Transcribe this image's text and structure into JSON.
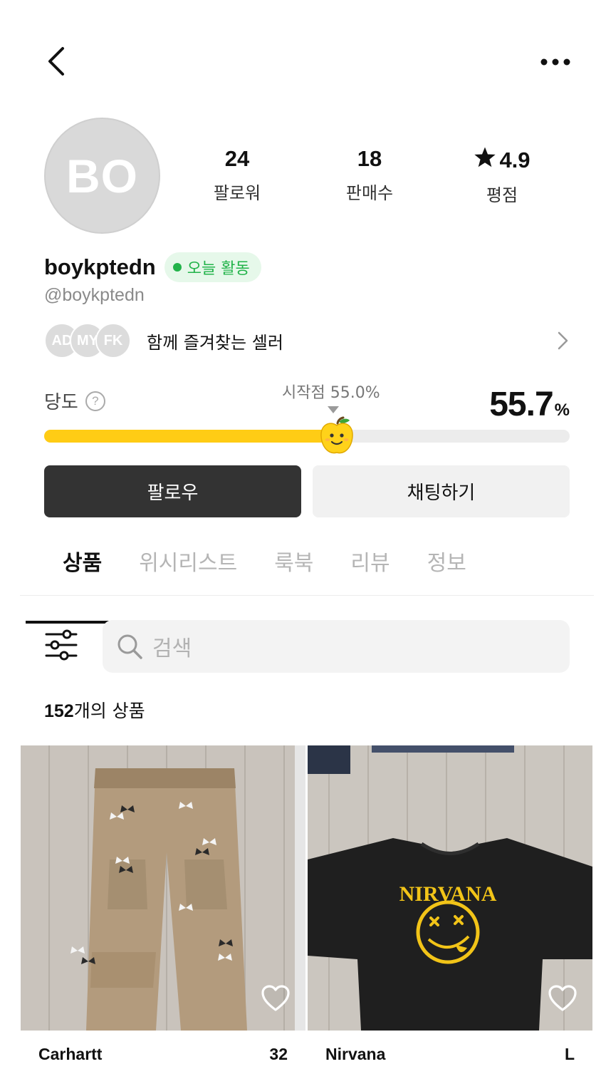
{
  "profile": {
    "avatar_initials": "BO",
    "username": "boykptedn",
    "handle": "@boykptedn",
    "active_badge": "오늘 활동",
    "stats": {
      "followers_value": "24",
      "followers_label": "팔로워",
      "sales_value": "18",
      "sales_label": "판매수",
      "rating_value": "4.9",
      "rating_label": "평점"
    }
  },
  "favorites": {
    "label": "함께 즐겨찾는 셀러",
    "avatars": [
      "AD",
      "MY",
      "FK"
    ]
  },
  "sugar": {
    "label": "당도",
    "start_label": "시작점 55.0%",
    "value": "55.7",
    "unit": "%",
    "level": 55.7,
    "start_level": 55.0
  },
  "actions": {
    "follow_label": "팔로우",
    "chat_label": "채팅하기"
  },
  "tabs": [
    {
      "label": "상품",
      "active": true
    },
    {
      "label": "위시리스트",
      "active": false
    },
    {
      "label": "룩북",
      "active": false
    },
    {
      "label": "리뷰",
      "active": false
    },
    {
      "label": "정보",
      "active": false
    }
  ],
  "search": {
    "placeholder": "검색"
  },
  "products": {
    "count_number": "152",
    "count_suffix": "개의 상품",
    "items": [
      {
        "brand": "Carhartt",
        "size": "32"
      },
      {
        "brand": "Nirvana",
        "size": "L"
      }
    ]
  },
  "colors": {
    "accent_yellow": "#ffcc15",
    "active_green": "#22b34a",
    "follow_button": "#333333"
  }
}
